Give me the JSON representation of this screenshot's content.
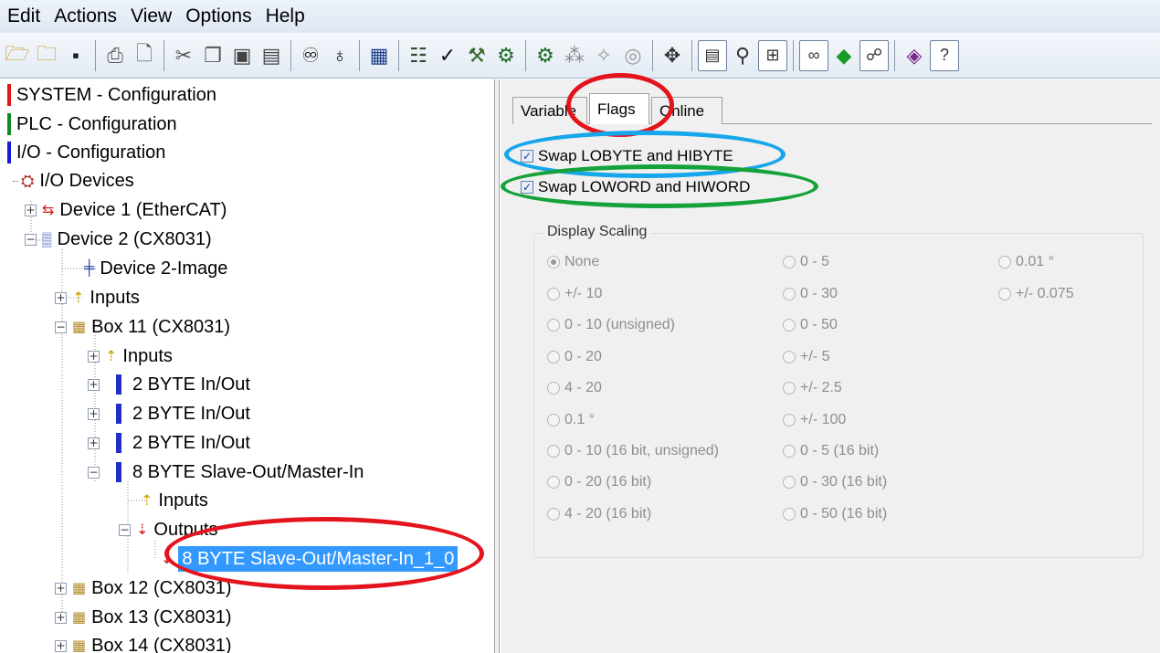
{
  "menu": [
    "Edit",
    "Actions",
    "View",
    "Options",
    "Help"
  ],
  "toolbar": {
    "buttons": [
      "open-icon",
      "open-project-icon",
      "save-icon",
      "sep",
      "print-icon",
      "print-preview-icon",
      "sep",
      "cut-icon",
      "copy-icon",
      "paste-icon",
      "paste-with-links-icon",
      "sep",
      "find-icon",
      "find-next-icon",
      "sep",
      "device-icon",
      "sep",
      "network-icon",
      "check-icon",
      "build-icon",
      "activate-icon",
      "sep",
      "restart-icon",
      "scan-icon",
      "wand-icon",
      "target-icon",
      "sep",
      "plugin-icon",
      "sep",
      "list-view-icon",
      "zoom-icon",
      "config-icon",
      "sep",
      "glasses-icon",
      "green-marker-icon",
      "mapping-icon",
      "sep",
      "help-book-icon",
      "help-icon"
    ]
  },
  "tree": {
    "items": [
      {
        "label": "SYSTEM - Configuration",
        "marker": "red"
      },
      {
        "label": "PLC - Configuration",
        "marker": "green"
      },
      {
        "label": "I/O - Configuration",
        "marker": "blue"
      },
      {
        "label": "I/O Devices"
      },
      {
        "label": "Device 1 (EtherCAT)"
      },
      {
        "label": "Device 2 (CX8031)"
      },
      {
        "label": "Device 2-Image"
      },
      {
        "label": "Inputs"
      },
      {
        "label": "Box 11 (CX8031)"
      },
      {
        "label": "Inputs"
      },
      {
        "label": "2 BYTE In/Out"
      },
      {
        "label": "2 BYTE In/Out"
      },
      {
        "label": "2 BYTE In/Out"
      },
      {
        "label": "8 BYTE Slave-Out/Master-In"
      },
      {
        "label": "Inputs"
      },
      {
        "label": "Outputs"
      },
      {
        "label": "8 BYTE Slave-Out/Master-In_1_0"
      },
      {
        "label": "Box 12 (CX8031)"
      },
      {
        "label": "Box 13 (CX8031)"
      },
      {
        "label": "Box 14 (CX8031)"
      }
    ]
  },
  "tabs": [
    {
      "label": "Variable"
    },
    {
      "label": "Flags"
    },
    {
      "label": "Online"
    }
  ],
  "flags": {
    "swap_bytes": {
      "label": "Swap LOBYTE and HIBYTE",
      "checked": true
    },
    "swap_words": {
      "label": "Swap LOWORD and HIWORD",
      "checked": true
    }
  },
  "scaling": {
    "legend": "Display Scaling",
    "col1": [
      "None",
      "+/- 10",
      "0 - 10 (unsigned)",
      "0 - 20",
      "4 - 20",
      "0.1 °",
      "0 - 10 (16 bit, unsigned)",
      "0 - 20 (16 bit)",
      "4 - 20 (16 bit)"
    ],
    "col2": [
      "0 - 5",
      "0 - 30",
      "0 - 50",
      "+/- 5",
      "+/- 2.5",
      "+/- 100",
      "0 - 5 (16 bit)",
      "0 - 30 (16 bit)",
      "0 - 50 (16 bit)"
    ],
    "col3": [
      "0.01 °",
      "+/- 0.075"
    ],
    "selected": "None"
  },
  "colors": {
    "annotation_red": "#e3141d",
    "annotation_blue": "#16a6ea",
    "annotation_green": "#15a23a",
    "selection": "#3399ff"
  }
}
